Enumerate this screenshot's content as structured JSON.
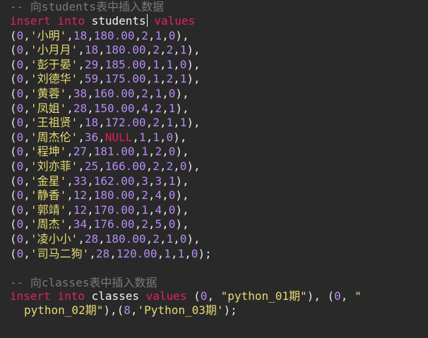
{
  "block1": {
    "comment_prefix": "-- ",
    "comment_text": "向students表中插入数据",
    "kw_insert": "insert",
    "kw_into": "into",
    "table": "students",
    "kw_values": "values",
    "rows": [
      {
        "id": "0",
        "name": "小明",
        "age": "18",
        "height": "180.00",
        "a": "2",
        "b": "1",
        "c": "0",
        "end": "),"
      },
      {
        "id": "0",
        "name": "小月月",
        "age": "18",
        "height": "180.00",
        "a": "2",
        "b": "2",
        "c": "1",
        "end": "),"
      },
      {
        "id": "0",
        "name": "彭于晏",
        "age": "29",
        "height": "185.00",
        "a": "1",
        "b": "1",
        "c": "0",
        "end": "),"
      },
      {
        "id": "0",
        "name": "刘德华",
        "age": "59",
        "height": "175.00",
        "a": "1",
        "b": "2",
        "c": "1",
        "end": "),"
      },
      {
        "id": "0",
        "name": "黄蓉",
        "age": "38",
        "height": "160.00",
        "a": "2",
        "b": "1",
        "c": "0",
        "end": "),"
      },
      {
        "id": "0",
        "name": "凤姐",
        "age": "28",
        "height": "150.00",
        "a": "4",
        "b": "2",
        "c": "1",
        "end": "),"
      },
      {
        "id": "0",
        "name": "王祖贤",
        "age": "18",
        "height": "172.00",
        "a": "2",
        "b": "1",
        "c": "1",
        "end": "),"
      },
      {
        "id": "0",
        "name": "周杰伦",
        "age": "36",
        "height": "NULL",
        "a": "1",
        "b": "1",
        "c": "0",
        "end": "),"
      },
      {
        "id": "0",
        "name": "程坤",
        "age": "27",
        "height": "181.00",
        "a": "1",
        "b": "2",
        "c": "0",
        "end": "),"
      },
      {
        "id": "0",
        "name": "刘亦菲",
        "age": "25",
        "height": "166.00",
        "a": "2",
        "b": "2",
        "c": "0",
        "end": "),"
      },
      {
        "id": "0",
        "name": "金星",
        "age": "33",
        "height": "162.00",
        "a": "3",
        "b": "3",
        "c": "1",
        "end": "),"
      },
      {
        "id": "0",
        "name": "静香",
        "age": "12",
        "height": "180.00",
        "a": "2",
        "b": "4",
        "c": "0",
        "end": "),"
      },
      {
        "id": "0",
        "name": "郭靖",
        "age": "12",
        "height": "170.00",
        "a": "1",
        "b": "4",
        "c": "0",
        "end": "),"
      },
      {
        "id": "0",
        "name": "周杰",
        "age": "34",
        "height": "176.00",
        "a": "2",
        "b": "5",
        "c": "0",
        "end": "),"
      },
      {
        "id": "0",
        "name": "凌小小",
        "age": "28",
        "height": "180.00",
        "a": "2",
        "b": "1",
        "c": "0",
        "end": "),"
      },
      {
        "id": "0",
        "name": "司马二狗",
        "age": "28",
        "height": "120.00",
        "a": "1",
        "b": "1",
        "c": "0",
        "end": ");"
      }
    ]
  },
  "block2": {
    "comment_prefix": "-- ",
    "comment_text": "向classes表中插入数据",
    "kw_insert": "insert",
    "kw_into": "into",
    "table": "classes",
    "kw_values": "values",
    "line1_rest_a": " (",
    "v1_id": "0",
    "v1_sep": ", ",
    "v1_str": "\"python_01期\"",
    "v1_end": "), (",
    "v2_id": "0",
    "v2_sep": ", ",
    "v2_str_open": "\"",
    "line2_str": "python_02期\"",
    "line2_mid": "),(",
    "v3_id": "8",
    "v3_sep": ",",
    "v3_str": "'Python_03期'",
    "line2_end": ");"
  },
  "colors": {
    "background": "#292929",
    "keyword": "#e21f5a",
    "number": "#b78cf3",
    "string": "#e6db74",
    "comment": "#7a7a7a"
  }
}
